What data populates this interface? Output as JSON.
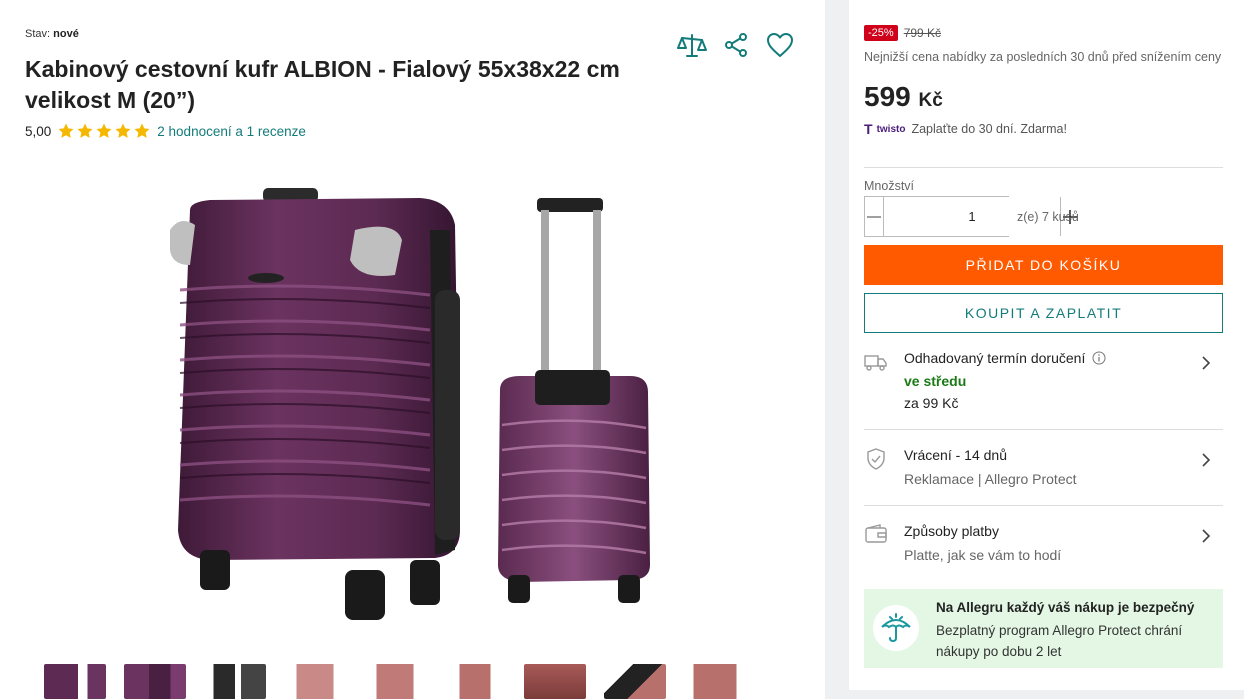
{
  "product": {
    "condition_label": "Stav:",
    "condition_value": "nové",
    "title": "Kabinový cestovní kufr ALBION - Fialový 55x38x22 cm velikost M (20”)",
    "rating_score": "5,00",
    "rating_stars": 5,
    "rating_link": "2 hodnocení a 1 recenze"
  },
  "actions": {
    "compare_icon": "scales-icon",
    "share_icon": "share-icon",
    "favorite_icon": "heart-icon"
  },
  "pricing": {
    "discount_badge": "-25%",
    "old_price": "799 Kč",
    "lowest_note": "Nejnižší cena nabídky za posledních 30 dnů před snížením ceny",
    "price_value": "599",
    "price_currency": "Kč",
    "twisto_logo_letter": "T",
    "twisto_logo_name": "twisto",
    "twisto_text": "Zaplaťte do 30 dní. Zdarma!"
  },
  "quantity": {
    "label": "Množství",
    "value": "1",
    "availability": "z(e) 7 kusů"
  },
  "buttons": {
    "add_to_cart": "PŘIDAT DO KOŠÍKU",
    "buy_now": "KOUPIT A ZAPLATIT"
  },
  "delivery": {
    "title": "Odhadovaný termín doručení",
    "when": "ve středu",
    "cost": "za 99 Kč"
  },
  "returns": {
    "title": "Vrácení - 14 dnů",
    "subtitle": "Reklamace | Allegro Protect"
  },
  "payment": {
    "title": "Způsoby platby",
    "subtitle": "Platte, jak se vám to hodí"
  },
  "protect": {
    "title": "Na Allegru každý váš nákup je bezpečný",
    "text": "Bezplatný program Allegro Protect chrání nákupy po dobu 2 let"
  },
  "colors": {
    "accent_teal": "#137c7a",
    "cart_orange": "#ff5a00",
    "discount_red": "#d0021b",
    "delivery_green": "#1a7a16",
    "protect_bg": "#e3f7e4",
    "star_yellow": "#f5b800",
    "suitcase_purple": "#5c2a52"
  }
}
